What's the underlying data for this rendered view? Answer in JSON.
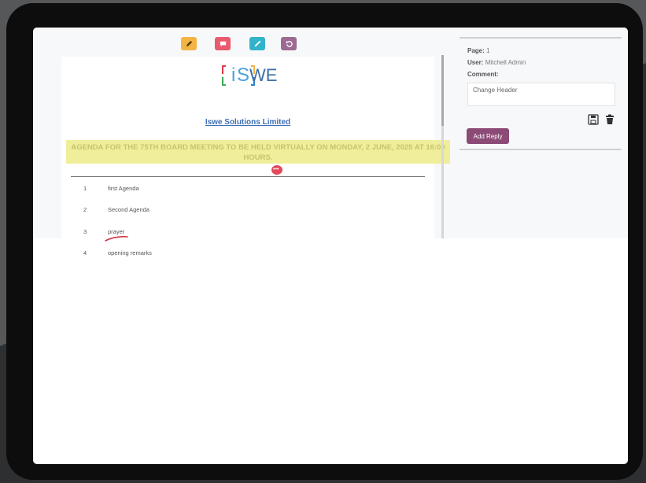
{
  "toolbar": {
    "tools": [
      {
        "name": "edit-tool",
        "icon": "pencil-icon",
        "color": "#f2b543"
      },
      {
        "name": "comment-tool",
        "icon": "comment-icon",
        "color": "#e95a6e"
      },
      {
        "name": "draw-tool",
        "icon": "brush-icon",
        "color": "#32b3c9"
      },
      {
        "name": "undo-tool",
        "icon": "undo-icon",
        "color": "#9c6a92"
      }
    ]
  },
  "document": {
    "logo_text": "ISWE",
    "company_name": "Iswe Solutions Limited",
    "agenda_title": "AGENDA FOR THE 75TH BOARD MEETING TO BE HELD VIRTUALLY ON MONDAY, 2 JUNE, 2025 AT 16:00 HOURS.",
    "comment_marker": "•••",
    "items": [
      {
        "num": "1",
        "text": "first Agenda"
      },
      {
        "num": "2",
        "text": "Second Agenda"
      },
      {
        "num": "3",
        "text": "prayer"
      },
      {
        "num": "4",
        "text": "opening remarks"
      }
    ]
  },
  "panel": {
    "page_label": "Page:",
    "page_value": "1",
    "user_label": "User:",
    "user_value": "Mitchell Admin",
    "comment_label": "Comment:",
    "comment_value": "Change Header",
    "reply_button": "Add Reply"
  },
  "colors": {
    "highlight": "#f1ee9b",
    "accent": "#8c4a76",
    "ink_annotation": "#d63344"
  }
}
